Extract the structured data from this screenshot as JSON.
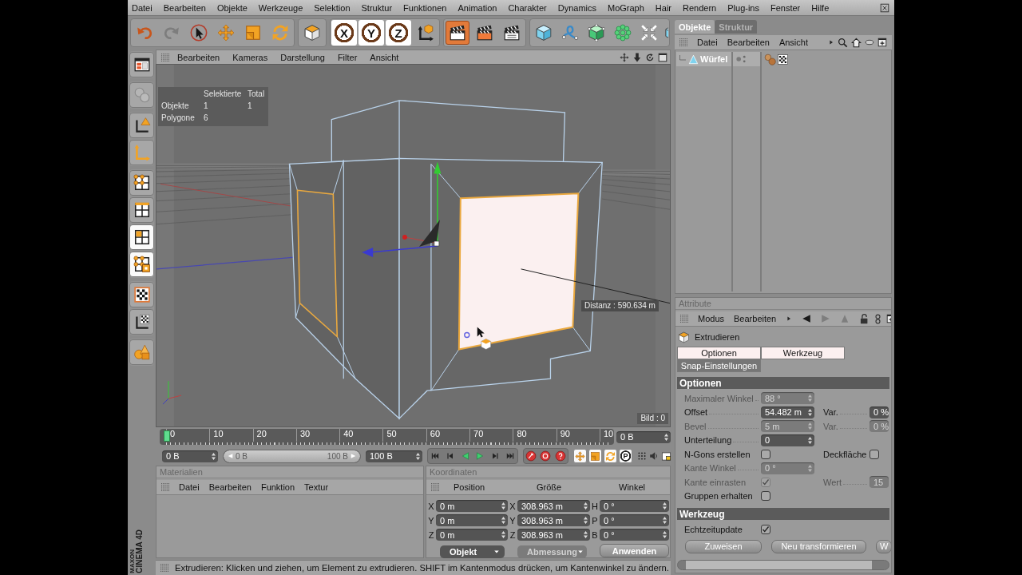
{
  "menu_bar": {
    "items": [
      "Datei",
      "Bearbeiten",
      "Objekte",
      "Werkzeuge",
      "Selektion",
      "Struktur",
      "Funktionen",
      "Animation",
      "Charakter",
      "Dynamics",
      "MoGraph",
      "Hair",
      "Rendern",
      "Plug-ins",
      "Fenster",
      "Hilfe"
    ]
  },
  "toolbar": {
    "groups": [
      [
        {
          "kind": "undo",
          "disabled": false
        },
        {
          "kind": "redo",
          "disabled": true
        },
        {
          "kind": "live-selection",
          "disabled": false
        },
        {
          "kind": "move",
          "disabled": false
        },
        {
          "kind": "scale",
          "disabled": false
        },
        {
          "kind": "rotate",
          "disabled": false
        }
      ],
      [
        {
          "kind": "model",
          "disabled": false
        }
      ],
      [
        {
          "kind": "axis-lock",
          "label": "X",
          "on": true
        },
        {
          "kind": "axis-lock",
          "label": "Y",
          "on": true
        },
        {
          "kind": "axis-lock",
          "label": "Z",
          "on": true
        },
        {
          "kind": "coordinate-system",
          "on": false
        }
      ]
    ]
  },
  "mode_palette": {
    "groups": [
      [
        {
          "kind": "layout",
          "selected": false,
          "disabled": false
        }
      ],
      [
        {
          "kind": "make-editable",
          "selected": false,
          "disabled": true
        }
      ],
      [
        {
          "kind": "object-axis",
          "selected": false,
          "disabled": false
        },
        {
          "kind": "model-axis",
          "selected": false,
          "disabled": false
        }
      ],
      [
        {
          "kind": "points",
          "selected": false,
          "disabled": false
        },
        {
          "kind": "edges",
          "selected": false,
          "disabled": false
        },
        {
          "kind": "polygons",
          "selected": true,
          "disabled": false
        },
        {
          "kind": "uv-polygons",
          "selected": true,
          "disabled": false
        }
      ],
      [
        {
          "kind": "texture",
          "selected": false,
          "disabled": false
        },
        {
          "kind": "texture-axis",
          "selected": false,
          "disabled": false
        }
      ],
      [
        {
          "kind": "primitives",
          "selected": false,
          "disabled": false
        }
      ]
    ]
  },
  "logo": {
    "brand": "MAXON",
    "product": "CINEMA 4D"
  },
  "viewport": {
    "menu": [
      "Bearbeiten",
      "Kameras",
      "Darstellung",
      "Filter",
      "Ansicht"
    ],
    "hud": {
      "columns": [
        "Selektierte",
        "Total"
      ],
      "rows": [
        {
          "label": "Objekte",
          "values": [
            "1",
            "1"
          ]
        },
        {
          "label": "Polygone",
          "values": [
            "6"
          ]
        }
      ]
    },
    "distance": "Distanz : 590.634 m",
    "frame": "Bild : 0"
  },
  "timeline": {
    "ticks": [
      "0",
      "10",
      "20",
      "30",
      "40",
      "50",
      "60",
      "70",
      "80",
      "90",
      "10"
    ],
    "playhead": {
      "level": 0
    },
    "current": "0 B"
  },
  "transport": {
    "start": "0 B",
    "range": {
      "start": "0 B",
      "end": "100 B",
      "level": 1
    },
    "end": "100 B",
    "param_key": "P"
  },
  "materials": {
    "title": "Materialien",
    "menu": [
      "Datei",
      "Bearbeiten",
      "Funktion",
      "Textur"
    ]
  },
  "coordinates": {
    "title": "Koordinaten",
    "headers": [
      "Position",
      "Größe",
      "Winkel"
    ],
    "rows": [
      {
        "position_axis": "X",
        "position": "0 m",
        "size_axis": "X",
        "size": "308.963 m",
        "angle_axis": "H",
        "angle": "0 °"
      },
      {
        "position_axis": "Y",
        "position": "0 m",
        "size_axis": "Y",
        "size": "308.963 m",
        "angle_axis": "P",
        "angle": "0 °"
      },
      {
        "position_axis": "Z",
        "position": "0 m",
        "size_axis": "Z",
        "size": "308.963 m",
        "angle_axis": "B",
        "angle": "0 °"
      }
    ],
    "dropdowns": [
      {
        "value": "Objekt",
        "disabled": false
      },
      {
        "value": "Abmessung",
        "disabled": true
      }
    ],
    "apply": "Anwenden"
  },
  "status_bar": {
    "text": "Extrudieren: Klicken und ziehen, um Element zu extrudieren. SHIFT im Kantenmodus drücken, um Kantenwinkel zu ändern."
  },
  "objects_panel": {
    "tabs": [
      {
        "label": "Objekte",
        "selected": true
      },
      {
        "label": "Struktur",
        "selected": false
      }
    ],
    "menu": [
      "Datei",
      "Bearbeiten",
      "Ansicht"
    ],
    "tree": [
      {
        "name": "Würfel",
        "selected": true
      }
    ]
  },
  "attributes_panel": {
    "title": "Attribute",
    "menu": [
      "Modus",
      "Bearbeiten"
    ],
    "tool": "Extrudieren",
    "tabs": [
      {
        "label": "Optionen",
        "selected": true
      },
      {
        "label": "Werkzeug",
        "selected": true
      },
      {
        "label": "Snap-Einstellungen",
        "selected": false
      }
    ],
    "sections": [
      {
        "title": "Optionen",
        "rows": [
          [
            {
              "kind": "number",
              "label": "Maximaler Winkel",
              "value": "88 °",
              "disabled": true
            }
          ],
          [
            {
              "kind": "number",
              "label": "Offset",
              "value": "54.482 m",
              "disabled": false
            },
            {
              "kind": "number",
              "label": "Var.",
              "value": "0 %",
              "disabled": false
            }
          ],
          [
            {
              "kind": "number",
              "label": "Bevel",
              "value": "5 m",
              "disabled": true
            },
            {
              "kind": "number",
              "label": "Var.",
              "value": "0 %",
              "disabled": true
            }
          ],
          [
            {
              "kind": "number",
              "label": "Unterteilung",
              "value": "0",
              "disabled": false
            }
          ],
          [
            {
              "kind": "checkbox",
              "label": "N-Gons erstellen",
              "checked": false,
              "disabled": false
            },
            {
              "kind": "checkbox",
              "label": "Deckfläche",
              "checked": false,
              "disabled": false
            }
          ],
          [
            {
              "kind": "number",
              "label": "Kante Winkel",
              "value": "0 °",
              "disabled": true
            }
          ],
          [
            {
              "kind": "checkbox",
              "label": "Kante einrasten",
              "checked": true,
              "disabled": true
            },
            {
              "kind": "number",
              "label": "Wert",
              "value": "15",
              "disabled": true
            }
          ],
          [
            {
              "kind": "checkbox",
              "label": "Gruppen erhalten",
              "checked": false,
              "disabled": false
            }
          ]
        ]
      },
      {
        "title": "Werkzeug",
        "rows": [
          [
            {
              "kind": "checkbox",
              "label": "Echtzeitupdate",
              "checked": true,
              "disabled": false
            }
          ]
        ],
        "buttons": [
          "Zuweisen",
          "Neu transformieren",
          "W"
        ]
      }
    ]
  }
}
